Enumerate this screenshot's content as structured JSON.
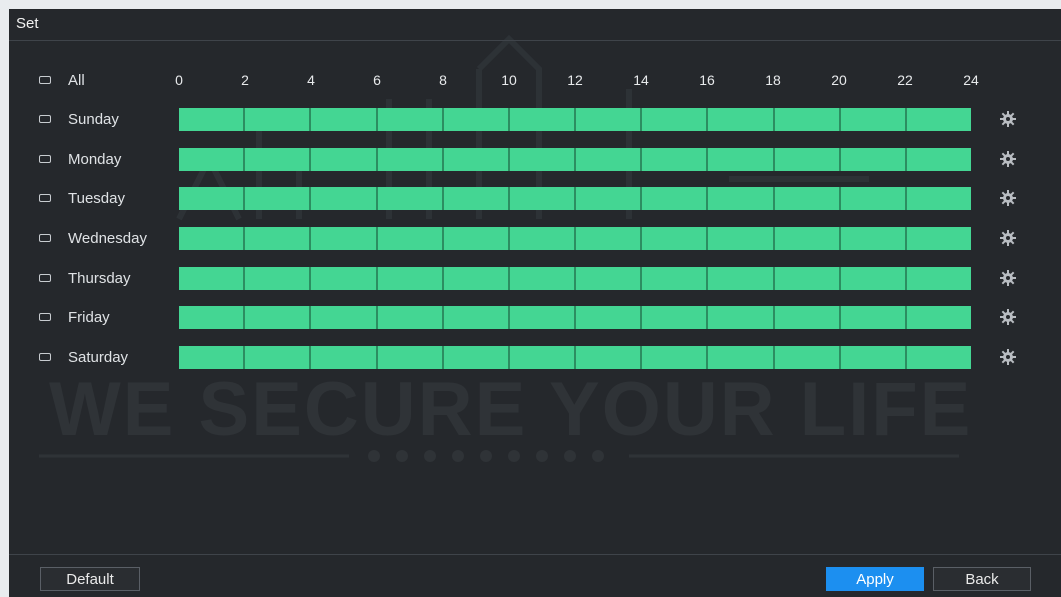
{
  "window": {
    "title": "Set"
  },
  "all_label": "All",
  "hours": [
    "0",
    "2",
    "4",
    "6",
    "8",
    "10",
    "12",
    "14",
    "16",
    "18",
    "20",
    "22",
    "24"
  ],
  "days": [
    {
      "label": "Sunday",
      "schedule": "00:00-24:00"
    },
    {
      "label": "Monday",
      "schedule": "00:00-24:00"
    },
    {
      "label": "Tuesday",
      "schedule": "00:00-24:00"
    },
    {
      "label": "Wednesday",
      "schedule": "00:00-24:00"
    },
    {
      "label": "Thursday",
      "schedule": "00:00-24:00"
    },
    {
      "label": "Friday",
      "schedule": "00:00-24:00"
    },
    {
      "label": "Saturday",
      "schedule": "00:00-24:00"
    }
  ],
  "colors": {
    "active_period": "#44d693",
    "accent": "#1c8ff0",
    "background": "#25282c"
  },
  "icons": {
    "day_setting": "gear-icon",
    "row_select": "checkbox"
  },
  "buttons": {
    "default": "Default",
    "apply": "Apply",
    "back": "Back"
  },
  "watermark": {
    "text": "WE SECURE YOUR LIFE"
  }
}
